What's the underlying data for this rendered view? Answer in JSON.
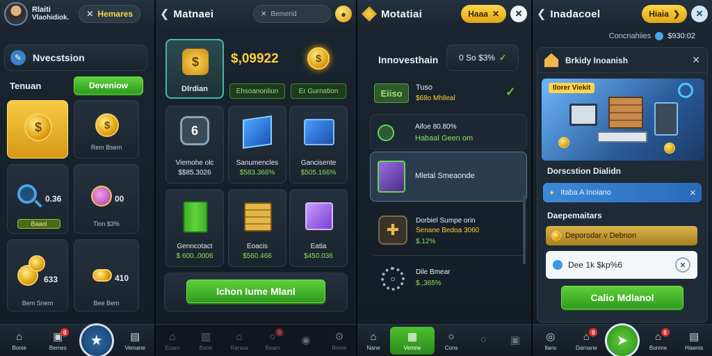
{
  "panel1": {
    "user_name": "Rlaiti",
    "user_sub": "Vlaohidiok.",
    "top_pill": "Hemares",
    "section_title": "Nvecstsion",
    "tab_label": "Tenuan",
    "tab_button": "Deveniow",
    "items": [
      {
        "caption": "",
        "sub": ""
      },
      {
        "caption": "Rem Bsem",
        "sub": ""
      },
      {
        "caption": "",
        "value": "0.36",
        "button": "Baaol",
        "sub": ""
      },
      {
        "caption": "",
        "value": "00",
        "sub": "Tion $3%"
      },
      {
        "caption": "Bem Snem",
        "value": "633"
      },
      {
        "caption": "Bee Bem",
        "value": "410"
      }
    ],
    "nav": [
      {
        "label": "Bonie",
        "icon": "home-icon"
      },
      {
        "label": "Bemes",
        "icon": "store-icon",
        "badge": "0"
      },
      {
        "label": "",
        "icon": "star-icon"
      },
      {
        "label": "Vemane",
        "icon": "wallet-icon"
      }
    ]
  },
  "panel2": {
    "title": "Matnaei",
    "search_placeholder": "Bemerid",
    "featured_label": "Dlrdian",
    "price": "$,09922",
    "btn_a": "Ehsoanonliun",
    "btn_b": "Er Gurnation",
    "items": [
      {
        "caption": "Viemohe olc",
        "sub": "$$85.3026"
      },
      {
        "caption": "Sanumencles",
        "sub": "$583.366%"
      },
      {
        "caption": "Gancisente",
        "sub": "$505.166%"
      },
      {
        "caption": "Genncotact",
        "sub": "$ 600..0006"
      },
      {
        "caption": "Eoacis",
        "sub": "$560.466"
      },
      {
        "caption": "Eatia",
        "sub": "$450.036"
      }
    ],
    "main_button": "Ichon Iume Mlanl",
    "nav": [
      {
        "label": "Eoam",
        "icon": "home-icon"
      },
      {
        "label": "Bane",
        "icon": "shop-icon"
      },
      {
        "label": "Ranisa",
        "icon": "house-icon"
      },
      {
        "label": "Beam",
        "icon": "search-icon",
        "badge": "0"
      },
      {
        "label": "",
        "icon": "medal-icon"
      },
      {
        "label": "Bome",
        "icon": "settings-icon"
      }
    ]
  },
  "panel3": {
    "title": "Motatiai",
    "top_pill": "Haaa",
    "section_title": "Innovesthain",
    "stat": "0 So $3%",
    "rows": [
      {
        "title": "Eiiso",
        "line1": "Tuso",
        "line2": "$68o Mhlleal"
      },
      {
        "title": "Aifoe 80.80%",
        "line2": "Habaal Geen om"
      },
      {
        "title": "Mletal Smeaonde",
        "line2": ""
      },
      {
        "title": "Dorbiel Sumpe orin",
        "line1": "Senane Bedoa 3060",
        "line2": "$.12%"
      },
      {
        "title": "Dile Bmear",
        "line2": "$.,365%"
      }
    ],
    "nav": [
      {
        "label": "Nane",
        "icon": "home-icon"
      },
      {
        "label": "Vemne",
        "icon": "map-icon"
      },
      {
        "label": "Cons",
        "icon": "coin-icon"
      },
      {
        "label": "",
        "icon": "search-icon"
      },
      {
        "label": "",
        "icon": "grid-icon"
      }
    ]
  },
  "panel4": {
    "title": "Inadacoel",
    "top_pill": "Hiaia",
    "coins_label": "Concnahiies",
    "coins_value": "$930:02",
    "card_title": "Brkidy Inoanish",
    "banner": "Ilorer Viekit",
    "section1": "Dorscstion Dialidn",
    "notify": "Itaba A Inoiano",
    "section2": "Daepemaitars",
    "option1": "Deporodar v Debnon",
    "option2": "Dee 1k $kp%6",
    "confirm": "Calio Mdlanol",
    "nav": [
      {
        "label": "Ilans",
        "icon": "compass-icon"
      },
      {
        "label": "Darnane",
        "icon": "house-icon",
        "badge": "0"
      },
      {
        "label": "",
        "icon": "send-icon"
      },
      {
        "label": "Bonme",
        "icon": "home-icon",
        "badge": "0"
      },
      {
        "label": "Hawnis",
        "icon": "list-icon"
      }
    ]
  },
  "colors": {
    "accent_gold": "#ffd54a",
    "accent_green": "#4fbf2f",
    "bg": "#1b2631"
  }
}
